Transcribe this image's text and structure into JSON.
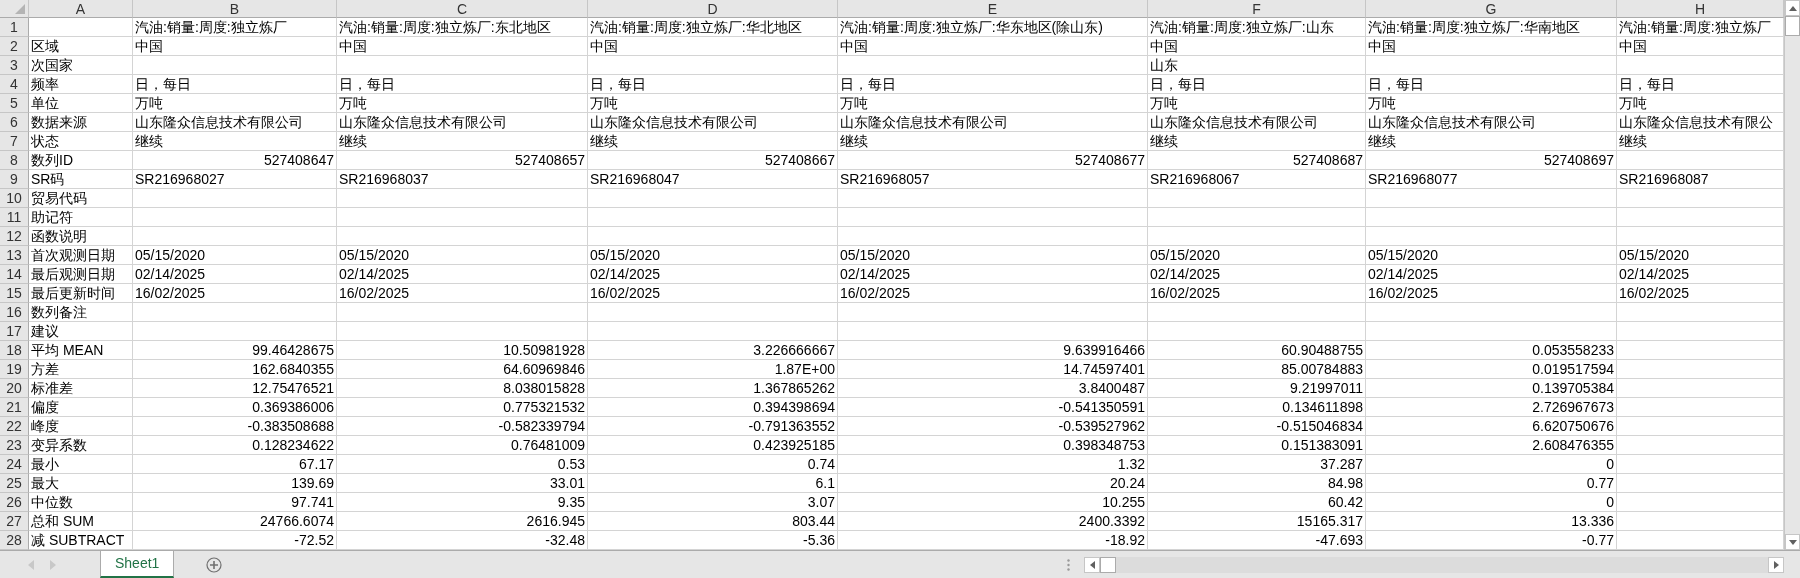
{
  "columns": [
    "A",
    "B",
    "C",
    "D",
    "E",
    "F",
    "G",
    "H"
  ],
  "rows": [
    {
      "number": "1",
      "kind": "text",
      "cells": {
        "B": "汽油:销量:周度:独立炼厂",
        "C": "汽油:销量:周度:独立炼厂:东北地区",
        "D": "汽油:销量:周度:独立炼厂:华北地区",
        "E": "汽油:销量:周度:独立炼厂:华东地区(除山东)",
        "F": "汽油:销量:周度:独立炼厂:山东",
        "G": "汽油:销量:周度:独立炼厂:华南地区",
        "H": "汽油:销量:周度:独立炼厂"
      }
    },
    {
      "number": "2",
      "kind": "text",
      "cells": {
        "A": "区域",
        "B": "中国",
        "C": "中国",
        "D": "中国",
        "E": "中国",
        "F": "中国",
        "G": "中国",
        "H": "中国"
      }
    },
    {
      "number": "3",
      "kind": "text",
      "cells": {
        "A": "次国家",
        "F": "山东"
      }
    },
    {
      "number": "4",
      "kind": "text",
      "cells": {
        "A": "频率",
        "B": "日，每日",
        "C": "日，每日",
        "D": "日，每日",
        "E": "日，每日",
        "F": "日，每日",
        "G": "日，每日",
        "H": "日，每日"
      }
    },
    {
      "number": "5",
      "kind": "text",
      "cells": {
        "A": "单位",
        "B": "万吨",
        "C": "万吨",
        "D": "万吨",
        "E": "万吨",
        "F": "万吨",
        "G": "万吨",
        "H": "万吨"
      }
    },
    {
      "number": "6",
      "kind": "text",
      "cells": {
        "A": "数据来源",
        "B": "山东隆众信息技术有限公司",
        "C": "山东隆众信息技术有限公司",
        "D": "山东隆众信息技术有限公司",
        "E": "山东隆众信息技术有限公司",
        "F": "山东隆众信息技术有限公司",
        "G": "山东隆众信息技术有限公司",
        "H": "山东隆众信息技术有限公"
      }
    },
    {
      "number": "7",
      "kind": "text",
      "cells": {
        "A": "状态",
        "B": "继续",
        "C": "继续",
        "D": "继续",
        "E": "继续",
        "F": "继续",
        "G": "继续",
        "H": "继续"
      }
    },
    {
      "number": "8",
      "kind": "numeric",
      "cells": {
        "A": "数列ID",
        "B": "527408647",
        "C": "527408657",
        "D": "527408667",
        "E": "527408677",
        "F": "527408687",
        "G": "527408697"
      }
    },
    {
      "number": "9",
      "kind": "text",
      "cells": {
        "A": "SR码",
        "B": "SR216968027",
        "C": "SR216968037",
        "D": "SR216968047",
        "E": "SR216968057",
        "F": "SR216968067",
        "G": "SR216968077",
        "H": "SR216968087"
      }
    },
    {
      "number": "10",
      "kind": "text",
      "cells": {
        "A": "贸易代码"
      }
    },
    {
      "number": "11",
      "kind": "text",
      "cells": {
        "A": "助记符"
      }
    },
    {
      "number": "12",
      "kind": "text",
      "cells": {
        "A": "函数说明"
      }
    },
    {
      "number": "13",
      "kind": "text",
      "cells": {
        "A": "首次观测日期",
        "B": "05/15/2020",
        "C": "05/15/2020",
        "D": "05/15/2020",
        "E": "05/15/2020",
        "F": "05/15/2020",
        "G": "05/15/2020",
        "H": "05/15/2020"
      }
    },
    {
      "number": "14",
      "kind": "text",
      "cells": {
        "A": "最后观测日期",
        "B": "02/14/2025",
        "C": "02/14/2025",
        "D": "02/14/2025",
        "E": "02/14/2025",
        "F": "02/14/2025",
        "G": "02/14/2025",
        "H": "02/14/2025"
      }
    },
    {
      "number": "15",
      "kind": "text",
      "cells": {
        "A": "最后更新时间",
        "B": "16/02/2025",
        "C": "16/02/2025",
        "D": "16/02/2025",
        "E": "16/02/2025",
        "F": "16/02/2025",
        "G": "16/02/2025",
        "H": "16/02/2025"
      }
    },
    {
      "number": "16",
      "kind": "text",
      "cells": {
        "A": "数列备注"
      }
    },
    {
      "number": "17",
      "kind": "text",
      "cells": {
        "A": "建议"
      }
    },
    {
      "number": "18",
      "kind": "numeric",
      "cells": {
        "A": "平均 MEAN",
        "B": "99.46428675",
        "C": "10.50981928",
        "D": "3.226666667",
        "E": "9.639916466",
        "F": "60.90488755",
        "G": "0.053558233"
      }
    },
    {
      "number": "19",
      "kind": "numeric",
      "cells": {
        "A": "方差",
        "B": "162.6840355",
        "C": "64.60969846",
        "D": "1.87E+00",
        "E": "14.74597401",
        "F": "85.00784883",
        "G": "0.019517594"
      }
    },
    {
      "number": "20",
      "kind": "numeric",
      "cells": {
        "A": "标准差",
        "B": "12.75476521",
        "C": "8.038015828",
        "D": "1.367865262",
        "E": "3.8400487",
        "F": "9.21997011",
        "G": "0.139705384"
      }
    },
    {
      "number": "21",
      "kind": "numeric",
      "cells": {
        "A": "偏度",
        "B": "0.369386006",
        "C": "0.775321532",
        "D": "0.394398694",
        "E": "-0.541350591",
        "F": "0.134611898",
        "G": "2.726967673"
      }
    },
    {
      "number": "22",
      "kind": "numeric",
      "cells": {
        "A": "峰度",
        "B": "-0.383508688",
        "C": "-0.582339794",
        "D": "-0.791363552",
        "E": "-0.539527962",
        "F": "-0.515046834",
        "G": "6.620750676"
      }
    },
    {
      "number": "23",
      "kind": "numeric",
      "cells": {
        "A": "变异系数",
        "B": "0.128234622",
        "C": "0.76481009",
        "D": "0.423925185",
        "E": "0.398348753",
        "F": "0.151383091",
        "G": "2.608476355"
      }
    },
    {
      "number": "24",
      "kind": "numeric",
      "cells": {
        "A": "最小",
        "B": "67.17",
        "C": "0.53",
        "D": "0.74",
        "E": "1.32",
        "F": "37.287",
        "G": "0"
      }
    },
    {
      "number": "25",
      "kind": "numeric",
      "cells": {
        "A": "最大",
        "B": "139.69",
        "C": "33.01",
        "D": "6.1",
        "E": "20.24",
        "F": "84.98",
        "G": "0.77"
      }
    },
    {
      "number": "26",
      "kind": "numeric",
      "cells": {
        "A": "中位数",
        "B": "97.741",
        "C": "9.35",
        "D": "3.07",
        "E": "10.255",
        "F": "60.42",
        "G": "0"
      }
    },
    {
      "number": "27",
      "kind": "numeric",
      "cells": {
        "A": "总和 SUM",
        "B": "24766.6074",
        "C": "2616.945",
        "D": "803.44",
        "E": "2400.3392",
        "F": "15165.317",
        "G": "13.336"
      }
    },
    {
      "number": "28",
      "kind": "numeric",
      "cells": {
        "A": "减 SUBTRACT",
        "B": "-72.52",
        "C": "-32.48",
        "D": "-5.36",
        "E": "-18.92",
        "F": "-47.693",
        "G": "-0.77"
      }
    }
  ],
  "sheet_tabs": [
    {
      "label": "Sheet1",
      "selected": true
    }
  ]
}
